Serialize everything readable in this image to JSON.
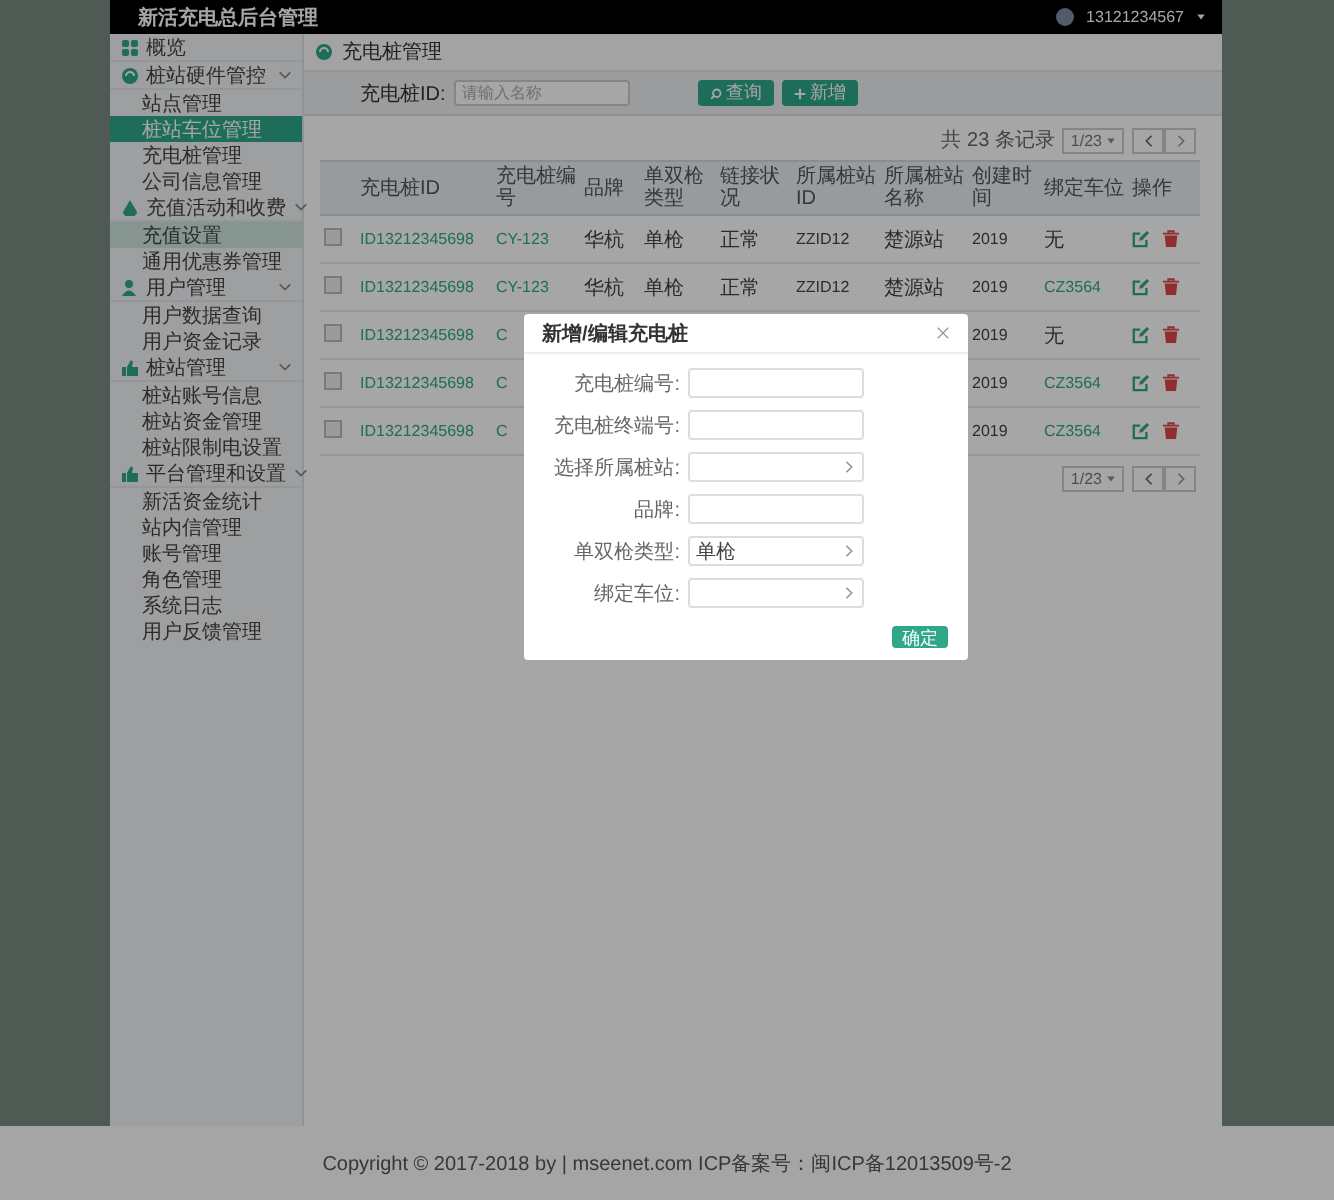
{
  "header": {
    "title": "新活充电总后台管理",
    "user": "13121234567"
  },
  "sidebar": {
    "items": [
      {
        "label": "概览",
        "kind": "link",
        "selected": false
      },
      {
        "label": "桩站硬件管控",
        "kind": "group",
        "expanded": true,
        "children": [
          {
            "label": "站点管理",
            "selected": false,
            "hovered": false
          },
          {
            "label": "桩站车位管理",
            "selected": true,
            "hovered": false
          },
          {
            "label": "充电桩管理",
            "selected": false,
            "hovered": false
          },
          {
            "label": "公司信息管理",
            "selected": false,
            "hovered": false
          }
        ]
      },
      {
        "label": "充值活动和收费",
        "kind": "group",
        "expanded": true,
        "children": [
          {
            "label": "充值设置",
            "selected": false,
            "hovered": true
          },
          {
            "label": "通用优惠券管理",
            "selected": false,
            "hovered": false
          }
        ]
      },
      {
        "label": "用户管理",
        "kind": "group",
        "expanded": true,
        "children": [
          {
            "label": "用户数据查询",
            "selected": false,
            "hovered": false
          },
          {
            "label": "用户资金记录",
            "selected": false,
            "hovered": false
          }
        ]
      },
      {
        "label": "桩站管理",
        "kind": "group",
        "expanded": true,
        "children": [
          {
            "label": "桩站账号信息",
            "selected": false,
            "hovered": false
          },
          {
            "label": "桩站资金管理",
            "selected": false,
            "hovered": false
          },
          {
            "label": "桩站限制电设置",
            "selected": false,
            "hovered": false
          }
        ]
      },
      {
        "label": "平台管理和设置",
        "kind": "group",
        "expanded": true,
        "children": [
          {
            "label": "新活资金统计",
            "selected": false,
            "hovered": false
          },
          {
            "label": "站内信管理",
            "selected": false,
            "hovered": false
          },
          {
            "label": "账号管理",
            "selected": false,
            "hovered": false
          },
          {
            "label": "角色管理",
            "selected": false,
            "hovered": false
          },
          {
            "label": "系统日志",
            "selected": false,
            "hovered": false
          },
          {
            "label": "用户反馈管理",
            "selected": false,
            "hovered": false
          }
        ]
      }
    ]
  },
  "page": {
    "title": "充电桩管理"
  },
  "filter": {
    "label": "充电桩ID:",
    "placeholder": "请输入名称",
    "buttons": [
      "查询",
      "新增"
    ]
  },
  "pagination_top": {
    "total": "共 23 条记录",
    "page": "1/23"
  },
  "table": {
    "columns": [
      "充电桩ID",
      "充电桩编号",
      "品牌",
      "单双枪类型",
      "链接状况",
      "所属桩站ID",
      "所属桩站名称",
      "创建时间",
      "绑定车位",
      "操作"
    ],
    "rows": [
      {
        "checked": false,
        "id": "ID13212345698",
        "code": "CY-123",
        "brand": "华杭",
        "gun_type": "单枪",
        "link_status": "正常",
        "station_id": "ZZID12",
        "station_name": "楚源站",
        "created": "2019",
        "spot": "无",
        "spot_linked": false
      },
      {
        "checked": false,
        "id": "ID13212345698",
        "code": "CY-123",
        "brand": "华杭",
        "gun_type": "单枪",
        "link_status": "正常",
        "station_id": "ZZID12",
        "station_name": "楚源站",
        "created": "2019",
        "spot": "CZ3564",
        "spot_linked": true
      },
      {
        "checked": false,
        "id": "ID13212345698",
        "code": "C",
        "created": "2019",
        "spot": "无",
        "spot_linked": false
      },
      {
        "checked": false,
        "id": "ID13212345698",
        "code": "C",
        "created": "2019",
        "spot": "CZ3564",
        "spot_linked": true
      },
      {
        "checked": false,
        "id": "ID13212345698",
        "code": "C",
        "created": "2019",
        "spot": "CZ3564",
        "spot_linked": true
      }
    ]
  },
  "pagination_bottom": {
    "page": "1/23"
  },
  "modal": {
    "title": "新增/编辑充电桩",
    "fields": [
      {
        "label": "充电桩编号:",
        "kind": "text"
      },
      {
        "label": "充电桩终端号:",
        "kind": "text"
      },
      {
        "label": "选择所属桩站:",
        "kind": "select"
      },
      {
        "label": "品牌:",
        "kind": "text"
      },
      {
        "label": "单双枪类型:",
        "kind": "select",
        "value": "单枪"
      },
      {
        "label": "绑定车位:",
        "kind": "select"
      }
    ],
    "confirm": "确定"
  },
  "footer": {
    "text": "Copyright © 2017-2018 by | mseenet.com ICP备案号：闽ICP备12013509号-2"
  }
}
